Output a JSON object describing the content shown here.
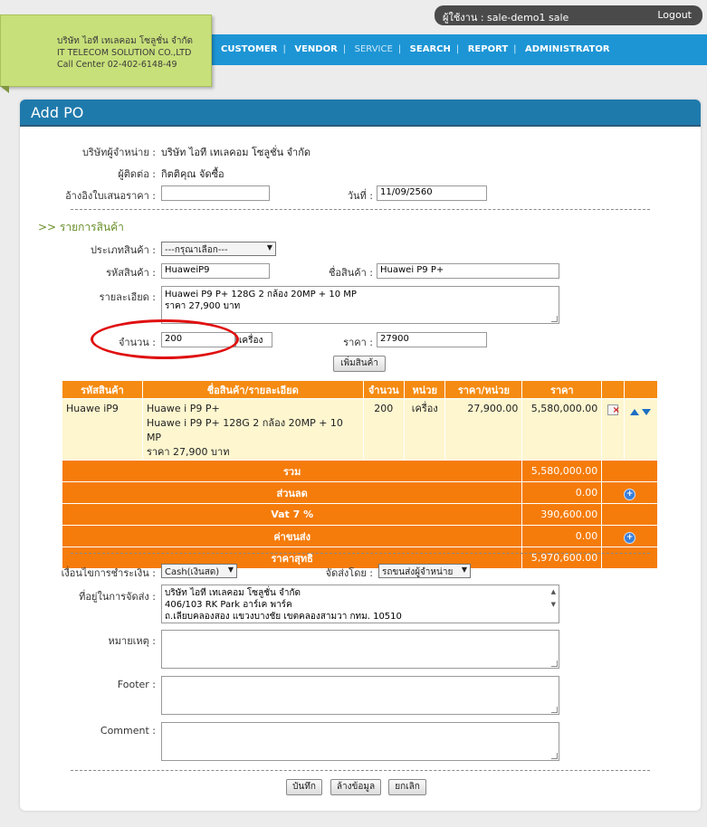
{
  "user": {
    "label": "ผู้ใช้งาน : sale-demo1 sale",
    "logout": "Logout"
  },
  "company_note": {
    "line1": "บริษัท ไอที เทเลคอม โซลูชั่น จำกัด",
    "line2": "IT TELECOM SOLUTION CO.,LTD",
    "line3": "Call Center 02-402-6148-49"
  },
  "nav": {
    "customer": "CUSTOMER",
    "vendor": "VENDOR",
    "service": "SERVICE",
    "search": "SEARCH",
    "report": "REPORT",
    "administrator": "ADMINISTRATOR",
    "sep": "|"
  },
  "page_title": "Add PO",
  "header_form": {
    "vendor_label": "บริษัทผู้จำหน่าย :",
    "vendor_value": "บริษัท ไอที เทเลคอม โซลูชั่น จำกัด",
    "contact_label": "ผู้ติดต่อ :",
    "contact_value": "กิตติคุณ จัดซื้อ",
    "quote_ref_label": "อ้างอิงใบเสนอราคา :",
    "quote_ref_value": "",
    "date_label": "วันที่ :",
    "date_value": "11/09/2560"
  },
  "section_items": ">> รายการสินค้า",
  "item_form": {
    "type_label": "ประเภทสินค้า :",
    "type_value": "---กรุณาเลือก---",
    "code_label": "รหัสสินค้า :",
    "code_value": "HuaweiP9",
    "name_label": "ชื่อสินค้า :",
    "name_value": "Huawei P9 P+",
    "detail_label": "รายละเอียด :",
    "detail_line1": "Huawei P9 P+ 128G 2 กล้อง 20MP  + 10 MP",
    "detail_line2": "ราคา 27,900 บาท",
    "qty_label": "จำนวน :",
    "qty_value": "200",
    "unit_value": "เครื่อง",
    "price_label": "ราคา :",
    "price_value": "27900",
    "add_button": "เพิ่มสินค้า"
  },
  "table": {
    "headers": [
      "รหัสสินค้า",
      "ชื่อสินค้า/รายละเอียด",
      "จำนวน",
      "หน่วย",
      "ราคา/หน่วย",
      "ราคา"
    ],
    "rows": [
      {
        "code": "Huawe iP9",
        "name1": "Huawe i P9 P+",
        "name2": "Huawe i P9 P+ 128G 2 กล้อง 20MP + 10 MP",
        "name3": "ราคา 27,900 บาท",
        "qty": "200",
        "unit": "เครื่อง",
        "unit_price": "27,900.00",
        "price": "5,580,000.00"
      }
    ],
    "summary": {
      "total_label": "รวม",
      "total": "5,580,000.00",
      "discount_label": "ส่วนลด",
      "discount": "0.00",
      "vat_label": "Vat 7 %",
      "vat": "390,600.00",
      "shipping_label": "ค่าขนส่ง",
      "shipping": "0.00",
      "net_label": "ราคาสุทธิ",
      "net": "5,970,600.00"
    }
  },
  "footer_form": {
    "payment_label": "เงื่อนไขการชำระเงิน :",
    "payment_value": "Cash(เงินสด)",
    "ship_by_label": "จัดส่งโดย :",
    "ship_by_value": "รถขนส่งผู้จำหน่าย",
    "address_label": "ที่อยู่ในการจัดส่ง :",
    "address_line1": "บริษัท ไอที เทเลคอม โซลูชั่น จำกัด",
    "address_line2": "406/103 RK Park อาร์เค พาร์ค",
    "address_line3": "ถ.เลียบคลองสอง แขวงบางชัย เขตคลองสามวา กทม. 10510",
    "remark_label": "หมายเหตุ :",
    "footer_label": "Footer :",
    "comment_label": "Comment :",
    "save_button": "บันทึก",
    "clear_button": "ล้างข้อมูล",
    "cancel_button": "ยกเลิก"
  }
}
